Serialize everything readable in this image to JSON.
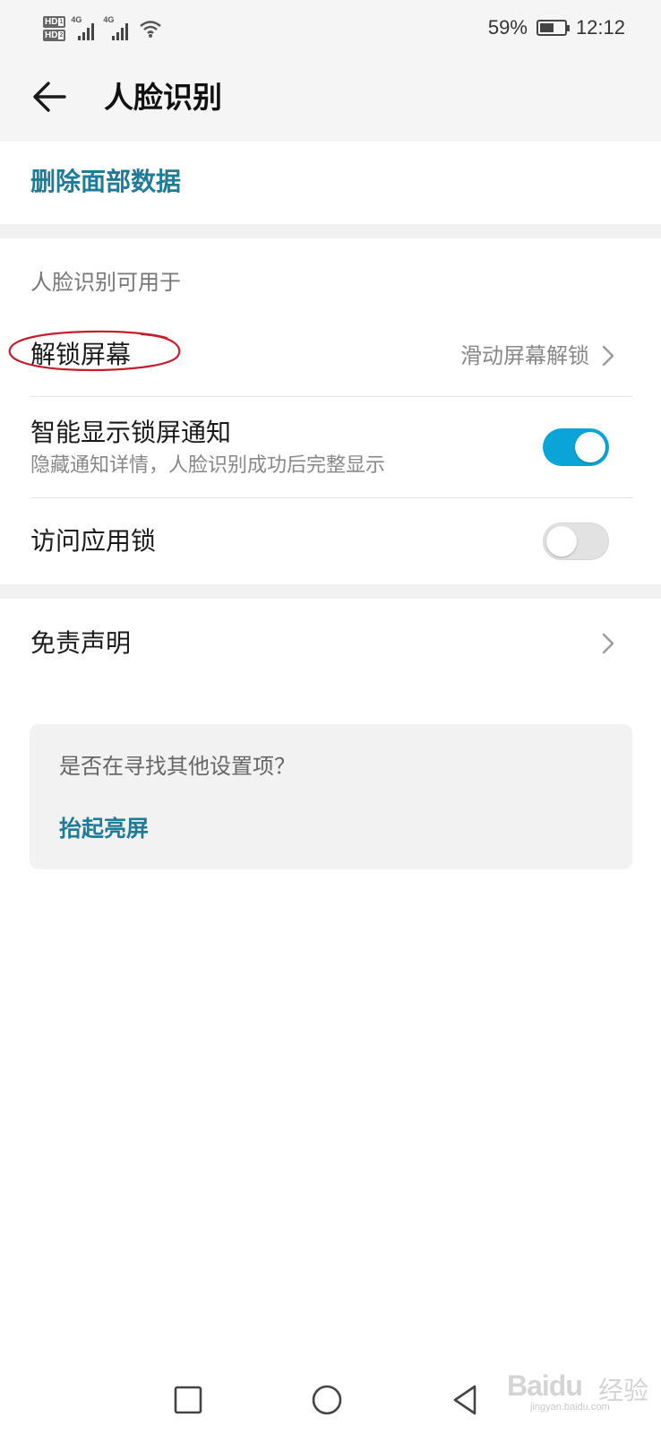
{
  "status_bar": {
    "sim1_label": "HD",
    "sim1_index": "1",
    "sim2_label": "HD",
    "sim2_index": "2",
    "network1": "4G",
    "network2": "4G",
    "battery_percent": "59%",
    "battery_level": 0.59,
    "time": "12:12"
  },
  "header": {
    "back_icon": "arrow-left-icon",
    "title": "人脸识别"
  },
  "delete_data": {
    "label": "删除面部数据"
  },
  "usage_section": {
    "label": "人脸识别可用于",
    "unlock_screen": {
      "title": "解锁屏幕",
      "value": "滑动屏幕解锁"
    },
    "smart_notifications": {
      "title": "智能显示锁屏通知",
      "subtitle": "隐藏通知详情，人脸识别成功后完整显示",
      "enabled": true
    },
    "app_lock": {
      "title": "访问应用锁",
      "enabled": false
    }
  },
  "disclaimer": {
    "title": "免责声明"
  },
  "suggestion": {
    "question": "是否在寻找其他设置项？",
    "link": "抬起亮屏"
  },
  "annotation": {
    "color": "#c41d2b"
  },
  "watermark": {
    "brand": "Bai",
    "paw": "du",
    "suffix": "经验",
    "url": "jingyan.baidu.com"
  },
  "nav_bar": {
    "recent_icon": "square-icon",
    "home_icon": "circle-icon",
    "back_icon": "triangle-back-icon"
  },
  "colors": {
    "accent": "#1f7c98",
    "switch_on": "#0aa4d9",
    "background_gray": "#f5f5f5"
  }
}
